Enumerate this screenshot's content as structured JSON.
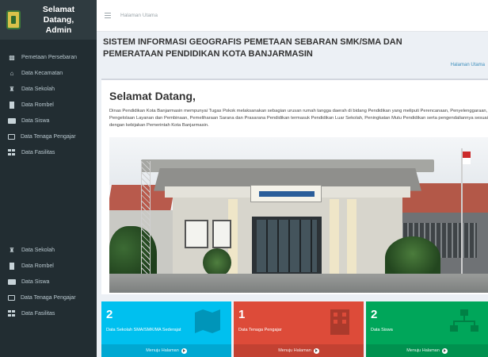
{
  "colors": {
    "sidebar_bg": "#222d32",
    "topbar_bg": "#ffffff",
    "content_bg": "#ecf0f5",
    "link": "#3c8dbc",
    "aqua": "#00c0ef",
    "red": "#dd4b39",
    "green": "#00a65a"
  },
  "sidebar": {
    "brand_line1": "Selamat Datang,",
    "brand_line2": "Admin",
    "logo_icon": "banjarmasin-emblem-icon",
    "menu_top": [
      {
        "label": "Pemetaan Persebaran",
        "icon": "sitemap-icon"
      },
      {
        "label": "Data Kecamatan",
        "icon": "home-icon"
      },
      {
        "label": "Data Sekolah",
        "icon": "school-icon"
      },
      {
        "label": "Data Rombel",
        "icon": "book-icon"
      },
      {
        "label": "Data Siswa",
        "icon": "id-card-icon"
      },
      {
        "label": "Data Tenaga Pengajar",
        "icon": "teacher-icon"
      },
      {
        "label": "Data Fasilitas",
        "icon": "table-icon"
      }
    ],
    "menu_bottom": [
      {
        "label": "Data Sekolah",
        "icon": "school-icon"
      },
      {
        "label": "Data Rombel",
        "icon": "book-icon"
      },
      {
        "label": "Data Siswa",
        "icon": "id-card-icon"
      },
      {
        "label": "Data Tenaga Pengajar",
        "icon": "teacher-icon"
      },
      {
        "label": "Data Fasilitas",
        "icon": "table-icon"
      }
    ]
  },
  "topbar": {
    "breadcrumb": "Halaman Utama"
  },
  "header": {
    "title_line1": "SISTEM INFORMASI GEOGRAFIS PEMETAAN SEBARAN SMK/SMA DAN",
    "title_line2": "PEMERATAAN PENDIDIKAN KOTA BANJARMASIN",
    "breadcrumb_right": "Halaman Utama"
  },
  "welcome": {
    "heading": "Selamat Datang,",
    "paragraph": "Dinas Pendidikan Kota Banjarmasin mempunyai Tugas Pokok melaksanakan sebagian urusan rumah tangga daerah di bidang Pendidikan yang meliputi Perencanaan, Penyelenggaraan, Pengelolaan Layanan dan Pembinaan, Pemeliharaan Sarana dan Prasarana Pendidikan termasuk Pendidikan Luar Sekolah, Peningkatan Mutu Pendidikan serta pengendaliannya sesuai dengan kebijakan Pemerintah Kota Banjarmasin."
  },
  "info_boxes": [
    {
      "count": "2",
      "label": "Data Sekolah SMA/SMK/MA Sederajat",
      "link": "Menuju Halaman",
      "icon": "map-icon",
      "color": "#00c0ef"
    },
    {
      "count": "1",
      "label": "Data Tenaga Pengajar",
      "link": "Menuju Halaman",
      "icon": "building-icon",
      "color": "#dd4b39"
    },
    {
      "count": "2",
      "label": "Data Siswa",
      "link": "Menuju Halaman",
      "icon": "sitemap-icon",
      "color": "#00a65a"
    }
  ]
}
